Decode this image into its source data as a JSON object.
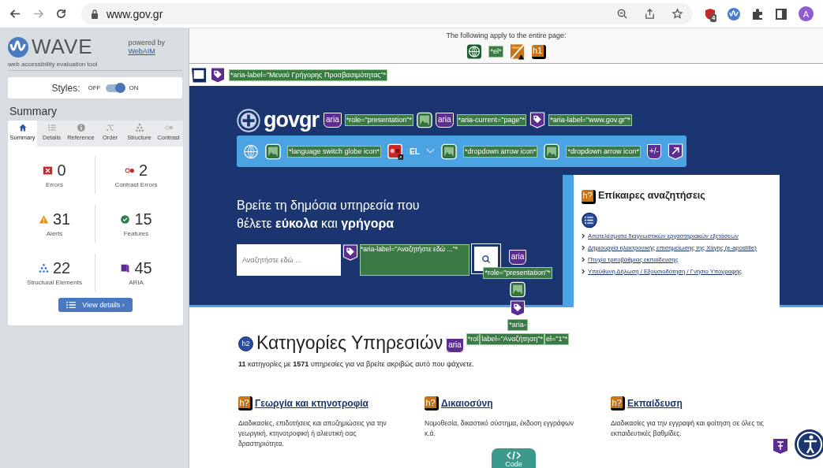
{
  "browser": {
    "url": "www.gov.gr",
    "extension_badge": "4",
    "avatar": "A"
  },
  "wave": {
    "title": "WAVE",
    "subtitle": "web accessibility evaluation tool",
    "powered_by": "powered by",
    "link": "WebAIM",
    "styles": {
      "label": "Styles:",
      "off_label": "OFF",
      "on_label": "ON",
      "on": true
    },
    "heading": "Summary",
    "tabs": [
      {
        "kind": "home",
        "label": "Summary",
        "selected": true
      },
      {
        "kind": "list",
        "label": "Details",
        "selected": false
      },
      {
        "kind": "info",
        "label": "Reference",
        "selected": false
      },
      {
        "kind": "order",
        "label": "Order",
        "selected": false
      },
      {
        "kind": "structure",
        "label": "Structure",
        "selected": false
      },
      {
        "kind": "contrast",
        "label": "Contrast",
        "selected": false
      }
    ],
    "stats": [
      {
        "kind": "error",
        "count": "0",
        "label": "Errors"
      },
      {
        "kind": "contrast",
        "count": "2",
        "label": "Contrast Errors"
      },
      {
        "kind": "alert",
        "count": "31",
        "label": "Alerts"
      },
      {
        "kind": "feature",
        "count": "15",
        "label": "Features"
      },
      {
        "kind": "structure",
        "count": "22",
        "label": "Structural Elements"
      },
      {
        "kind": "aria",
        "count": "45",
        "label": "ARIA"
      }
    ],
    "button": "View details ›"
  },
  "page": {
    "note": "The following apply to the entire page:",
    "page_marks": [
      {
        "kind": "globe"
      },
      {
        "kind": "label",
        "text": "*el*"
      },
      {
        "kind": "frame-alert"
      },
      {
        "kind": "heading-alert",
        "text": "h1"
      }
    ],
    "skip_marks": [
      {
        "kind": "landmark"
      },
      {
        "kind": "tag"
      },
      {
        "kind": "label",
        "text": "*aria-label=\"Μενού Γρήγορης Προσβασιμότητας\"*"
      }
    ]
  },
  "header": {
    "logo": "govgr",
    "marks": [
      {
        "kind": "aria",
        "text": "aria"
      },
      {
        "kind": "label",
        "text": "*role=\"presentation\"*"
      },
      {
        "kind": "image"
      },
      {
        "kind": "aria",
        "text": "aria"
      },
      {
        "kind": "label",
        "text": "*aria-current=\"page\"*"
      },
      {
        "kind": "tag"
      },
      {
        "kind": "label",
        "text": "*aria-label=\"www.gov.gr\"*"
      }
    ],
    "toolbar": [
      {
        "kind": "globe-outline"
      },
      {
        "kind": "image"
      },
      {
        "kind": "label",
        "text": "*language switch globe icon*"
      },
      {
        "kind": "lang-error"
      },
      {
        "kind": "text",
        "text": "EL"
      },
      {
        "kind": "caret"
      },
      {
        "kind": "image"
      },
      {
        "kind": "label",
        "text": "*dropdown arrow icon*"
      },
      {
        "kind": "image"
      },
      {
        "kind": "label",
        "text": "*dropdown arrow icon*"
      },
      {
        "kind": "aria",
        "text": "+/-"
      },
      {
        "kind": "aria-arrow"
      }
    ]
  },
  "hero": {
    "lines": [
      "Βρείτε τη δημόσια υπηρεσία που",
      "θέλετε **εύκολα** και **γρήγορα**"
    ],
    "search": {
      "placeholder": "Αναζητήστε εδώ ..."
    },
    "search_tag": {
      "kind": "tag"
    },
    "search_label": "*aria-label=\"Αναζητήστε εδώ ...\"*",
    "stack": [
      {
        "kind": "aria",
        "text": "aria"
      },
      {
        "kind": "label",
        "text": "*role=\"presentation\"*"
      },
      {
        "kind": "image"
      },
      {
        "kind": "tag"
      },
      {
        "kind": "label",
        "text": "*aria-"
      }
    ],
    "stack_row": [
      "*rol",
      "label=\"Αναζήτηση\"*",
      "el=\"1\"*"
    ]
  },
  "popular": {
    "mark": {
      "kind": "heading-alert",
      "text": "h?"
    },
    "heading": "Επίκαιρες αναζητήσεις",
    "list_mark": {
      "kind": "list"
    },
    "links": [
      "Αποτελέσματα διαγνωστικών εργαστηριακών εξετάσεων",
      "Δημιουργία ηλεκτρονικής επισημείωσης της Χάγης (e-apostille)",
      "Πτυχία τριτοβάθμιας εκπαίδευσης",
      "Υπεύθυνη Δήλωση / Εξουσιοδότηση / Γνήσιο Υπογραφής"
    ]
  },
  "section": {
    "mark": {
      "kind": "heading",
      "text": "h2"
    },
    "title": "Κατηγορίες Υπηρεσιών",
    "title_mark": {
      "kind": "aria",
      "text": "aria"
    },
    "summary": "**11** κατηγορίες με **1571** υπηρεσίες για να βρείτε ακριβώς αυτό που ψάχνετε."
  },
  "categories": [
    {
      "mark": {
        "kind": "heading-alert",
        "text": "h?"
      },
      "title": "Γεωργία και κτηνοτροφία",
      "description": "Διαδικασίες, επιδοτήσεις και αποζημιώσεις για την γεωργική, κτηνοτροφική ή αλιευτική σας δραστηριότητα."
    },
    {
      "mark": {
        "kind": "heading-alert",
        "text": "h?"
      },
      "title": "Δικαιοσύνη",
      "description": "Νομοθεσία, δικαστικό σύστημα, έκδοση εγγράφων κ.ά."
    },
    {
      "mark": {
        "kind": "heading-alert",
        "text": "h?"
      },
      "title": "Εκπαίδευση",
      "description": "Διαδικασίες για την εγγραφή και φοίτηση σε όλες τις εκπαιδευτικές βαθμίδες."
    }
  ],
  "code_button": "Code"
}
